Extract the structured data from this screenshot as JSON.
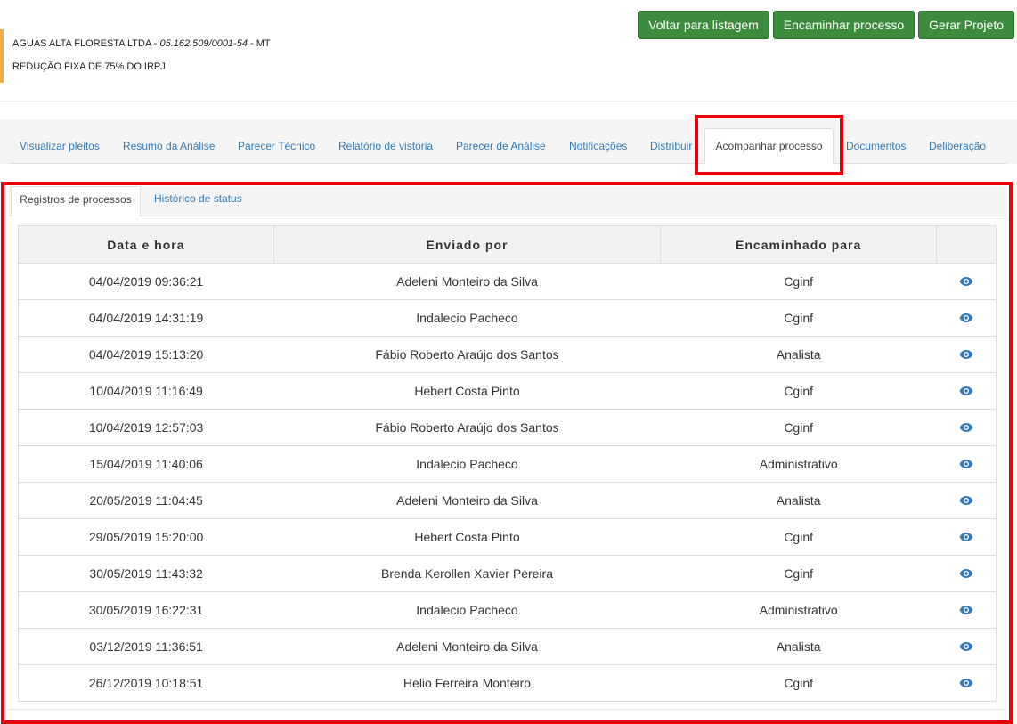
{
  "header": {
    "company_name": "AGUAS ALTA FLORESTA LTDA",
    "separator": " - ",
    "cnpj": "05.162.509/0001-54",
    "state_separator": " - ",
    "state": "MT",
    "benefit": "REDUÇÃO FIXA DE 75% DO IRPJ",
    "accent_color": "#f0ad4e"
  },
  "actions": {
    "back_label": "Voltar para listagem",
    "forward_label": "Encaminhar processo",
    "generate_label": "Gerar Projeto",
    "color": "#3d8b3d"
  },
  "tabs": [
    {
      "label": "Visualizar pleitos"
    },
    {
      "label": "Resumo da Análise"
    },
    {
      "label": "Parecer Técnico"
    },
    {
      "label": "Relatório de vistoria"
    },
    {
      "label": "Parecer de Análise"
    },
    {
      "label": "Notificações"
    },
    {
      "label": "Distribuir"
    },
    {
      "label": "Acompanhar processo",
      "active": true
    },
    {
      "label": "Documentos"
    },
    {
      "label": "Deliberação"
    }
  ],
  "subtabs": [
    {
      "label": "Registros de processos",
      "active": true
    },
    {
      "label": "Histórico de status"
    }
  ],
  "table": {
    "headers": [
      "Data e hora",
      "Enviado por",
      "Encaminhado para"
    ],
    "action_icon": "eye-icon",
    "rows": [
      {
        "date": "04/04/2019 09:36:21",
        "sender": "Adeleni Monteiro da Silva",
        "destination": "Cginf"
      },
      {
        "date": "04/04/2019 14:31:19",
        "sender": "Indalecio Pacheco",
        "destination": "Cginf"
      },
      {
        "date": "04/04/2019 15:13:20",
        "sender": "Fábio Roberto Araújo dos Santos",
        "destination": "Analista"
      },
      {
        "date": "10/04/2019 11:16:49",
        "sender": "Hebert Costa Pinto",
        "destination": "Cginf"
      },
      {
        "date": "10/04/2019 12:57:03",
        "sender": "Fábio Roberto Araújo dos Santos",
        "destination": "Cginf"
      },
      {
        "date": "15/04/2019 11:40:06",
        "sender": "Indalecio Pacheco",
        "destination": "Administrativo"
      },
      {
        "date": "20/05/2019 11:04:45",
        "sender": "Adeleni Monteiro da Silva",
        "destination": "Analista"
      },
      {
        "date": "29/05/2019 15:20:00",
        "sender": "Hebert Costa Pinto",
        "destination": "Cginf"
      },
      {
        "date": "30/05/2019 11:43:32",
        "sender": "Brenda Kerollen Xavier Pereira",
        "destination": "Cginf"
      },
      {
        "date": "30/05/2019 16:22:31",
        "sender": "Indalecio Pacheco",
        "destination": "Administrativo"
      },
      {
        "date": "03/12/2019 11:36:51",
        "sender": "Adeleni Monteiro da Silva",
        "destination": "Analista"
      },
      {
        "date": "26/12/2019 10:18:51",
        "sender": "Helio Ferreira Monteiro",
        "destination": "Cginf"
      }
    ]
  },
  "highlight_color": "#e8000b",
  "link_color": "#337ab7"
}
